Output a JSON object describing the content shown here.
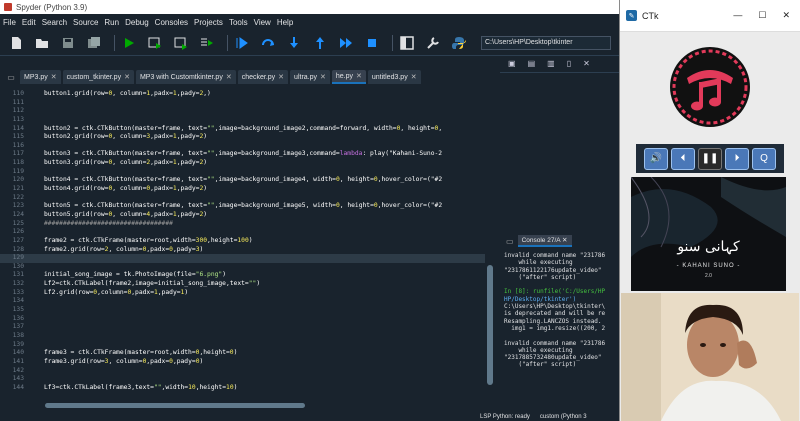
{
  "spyder": {
    "title": "Spyder (Python 3.9)",
    "menu": [
      "File",
      "Edit",
      "Search",
      "Source",
      "Run",
      "Debug",
      "Consoles",
      "Projects",
      "Tools",
      "View",
      "Help"
    ],
    "path": "C:\\Users\\HP\\Desktop\\tkinter\\he.py",
    "working_dir": "C:\\Users\\HP\\Desktop\\tkinter",
    "tabs": [
      {
        "label": "MP3.py",
        "active": false
      },
      {
        "label": "custom_tkinter.py",
        "active": false
      },
      {
        "label": "MP3 with Customtkinter.py",
        "active": false
      },
      {
        "label": "checker.py",
        "active": false
      },
      {
        "label": "ultra.py",
        "active": false
      },
      {
        "label": "he.py",
        "active": true
      },
      {
        "label": "untitled3.py",
        "active": false
      }
    ],
    "code_lines": [
      {
        "n": "110",
        "t": "button1.grid(row=0, column=1,padx=1,pady=2,)"
      },
      {
        "n": "111",
        "t": ""
      },
      {
        "n": "112",
        "t": ""
      },
      {
        "n": "113",
        "t": ""
      },
      {
        "n": "114",
        "t": "button2 = ctk.CTkButton(master=frame, text=\"\",image=background_image2,command=forward, width=0, height=0,"
      },
      {
        "n": "115",
        "t": "button2.grid(row=0, column=3,padx=1,pady=2)"
      },
      {
        "n": "116",
        "t": ""
      },
      {
        "n": "117",
        "t": "button3 = ctk.CTkButton(master=frame, text=\"\",image=background_image3,command=lambda: play(\"Kahani-Suno-2"
      },
      {
        "n": "118",
        "t": "button3.grid(row=0, column=2,padx=1,pady=2)"
      },
      {
        "n": "119",
        "t": ""
      },
      {
        "n": "120",
        "t": "button4 = ctk.CTkButton(master=frame, text=\"\",image=background_image4, width=0, height=0,hover_color=(\"#2"
      },
      {
        "n": "121",
        "t": "button4.grid(row=0, column=0,padx=1,pady=2)"
      },
      {
        "n": "122",
        "t": ""
      },
      {
        "n": "123",
        "t": "button5 = ctk.CTkButton(master=frame, text=\"\",image=background_image5, width=0, height=0,hover_color=(\"#2"
      },
      {
        "n": "124",
        "t": "button5.grid(row=0, column=4,padx=1,pady=2)"
      },
      {
        "n": "125",
        "t": "##################################"
      },
      {
        "n": "126",
        "t": ""
      },
      {
        "n": "127",
        "t": "frame2 = ctk.CTkFrame(master=root,width=300,height=100)"
      },
      {
        "n": "128",
        "t": "frame2.grid(row=2, column=0,padx=0,pady=3)"
      },
      {
        "n": "129",
        "t": ""
      },
      {
        "n": "130",
        "t": ""
      },
      {
        "n": "131",
        "t": "initial_song_image = tk.PhotoImage(file=\"6.png\")"
      },
      {
        "n": "132",
        "t": "Lf2=ctk.CTkLabel(frame2,image=initial_song_image,text=\"\")"
      },
      {
        "n": "133",
        "t": "Lf2.grid(row=0,column=0,padx=1,pady=1)"
      },
      {
        "n": "134",
        "t": ""
      },
      {
        "n": "135",
        "t": ""
      },
      {
        "n": "136",
        "t": ""
      },
      {
        "n": "137",
        "t": ""
      },
      {
        "n": "138",
        "t": ""
      },
      {
        "n": "139",
        "t": ""
      },
      {
        "n": "140",
        "t": "frame3 = ctk.CTkFrame(master=root,width=0,height=0)"
      },
      {
        "n": "141",
        "t": "frame3.grid(row=3, column=0,padx=0,pady=0)"
      },
      {
        "n": "142",
        "t": ""
      },
      {
        "n": "143",
        "t": ""
      },
      {
        "n": "144",
        "t": "Lf3=ctk.CTkLabel(frame3,text=\"\",width=10,height=10)"
      }
    ],
    "current_line": "129",
    "console_tab": "Console 27/A",
    "console_lines": [
      {
        "t": "invalid command name \"231786",
        "c": ""
      },
      {
        "t": "    while executing",
        "c": ""
      },
      {
        "t": "\"2317861122176update_video\"",
        "c": ""
      },
      {
        "t": "    (\"after\" script)",
        "c": ""
      },
      {
        "t": "",
        "c": ""
      },
      {
        "t": "In [8]: runfile('C:/Users/HP",
        "c": "in"
      },
      {
        "t": "HP/Desktop/tkinter')",
        "c": "lnk"
      },
      {
        "t": "C:\\Users\\HP\\Desktop\\tkinter\\",
        "c": ""
      },
      {
        "t": "is deprecated and will be re",
        "c": ""
      },
      {
        "t": "Resampling.LANCZOS instead.",
        "c": ""
      },
      {
        "t": "  img1 = img1.resize((200, 2",
        "c": ""
      },
      {
        "t": "",
        "c": ""
      },
      {
        "t": "invalid command name \"231786",
        "c": ""
      },
      {
        "t": "    while executing",
        "c": ""
      },
      {
        "t": "\"2317885732480update_video\"",
        "c": ""
      },
      {
        "t": "    (\"after\" script)",
        "c": ""
      }
    ],
    "status": [
      "LSP Python: ready",
      "custom (Python 3"
    ]
  },
  "ctk": {
    "title": "CTk",
    "win_buttons": [
      "—",
      "☐",
      "✕"
    ],
    "controls": [
      {
        "name": "volume-button",
        "glyph": "🔊"
      },
      {
        "name": "previous-button",
        "glyph": "⏴"
      },
      {
        "name": "pause-button",
        "glyph": "❚❚"
      },
      {
        "name": "next-button",
        "glyph": "⏵"
      },
      {
        "name": "search-button",
        "glyph": "Q"
      }
    ],
    "cover": {
      "title_urdu": "کہانی سنو",
      "title_en": "- KAHANI SUNO -",
      "version": "2.0"
    }
  },
  "colors": {
    "bg": "#19232d",
    "accent": "#1a72bb",
    "player_btn": "#4a78b8"
  }
}
